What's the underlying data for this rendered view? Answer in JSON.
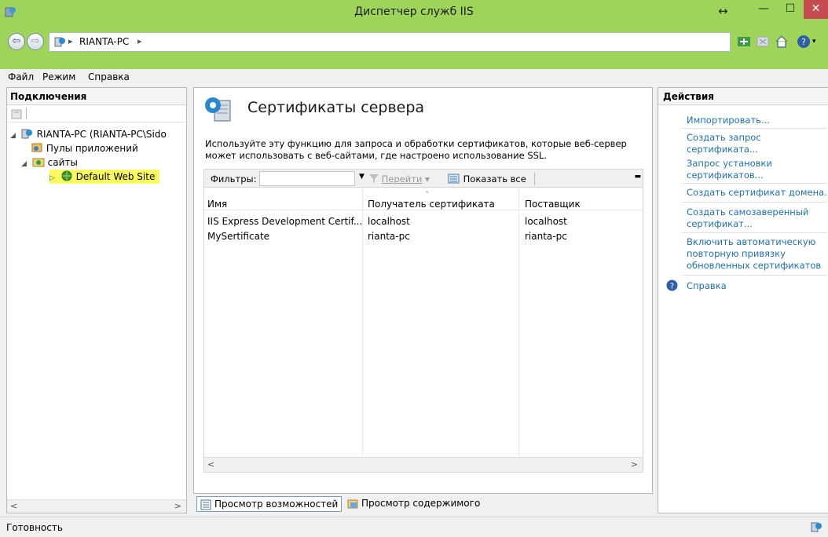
{
  "window": {
    "title": "Диспетчер служб IIS"
  },
  "address": {
    "crumb": "RIANTA-PC"
  },
  "menu": {
    "items": [
      "Файл",
      "Режим",
      "Справка"
    ]
  },
  "connections": {
    "header": "Подключения",
    "tree": [
      {
        "label": "RIANTA-PC (RIANTA-PC\\Sido",
        "level": 0
      },
      {
        "label": "Пулы приложений",
        "level": 1
      },
      {
        "label": "сайты",
        "level": 1
      },
      {
        "label": "Default Web Site",
        "level": 2
      }
    ]
  },
  "feature": {
    "title": "Сертификаты сервера",
    "description": "Используйте эту функцию для запроса и обработки сертификатов, которые веб-сервер может использовать с веб-сайтами, где настроено использование SSL."
  },
  "filter": {
    "label": "Фильтры:",
    "go_label": "Перейти",
    "show_all_label": "Показать все"
  },
  "table": {
    "columns": [
      "Имя",
      "Получатель сертификата",
      "Поставщик"
    ],
    "rows": [
      [
        "IIS Express Development Certif...",
        "localhost",
        "localhost"
      ],
      [
        "MySertificate",
        "rianta-pc",
        "rianta-pc"
      ]
    ]
  },
  "viewtabs": {
    "features": "Просмотр возможностей",
    "content": "Просмотр содержимого"
  },
  "actions": {
    "header": "Действия",
    "items": [
      "Импортировать...",
      "Создать запрос",
      "сертификата...",
      "Запрос установки",
      "сертификатов...",
      "Создать сертификат домена...",
      "Создать самозаверенный",
      "сертификат...",
      "Включить автоматическую",
      "повторную привязку",
      "обновленных сертификатов",
      "Справка"
    ]
  },
  "status": {
    "text": "Готовность"
  },
  "colors": {
    "titlebar": "#9fd45a",
    "link": "#1f6fb5",
    "highlight": "#fafa5c",
    "close": "#c74b50"
  }
}
